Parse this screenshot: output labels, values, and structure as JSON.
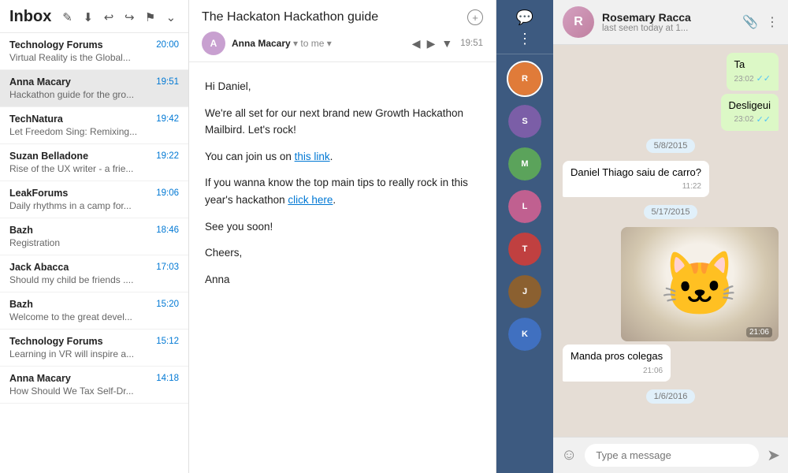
{
  "inbox": {
    "title": "Inbox",
    "toolbar_icons": [
      "compose",
      "download",
      "undo",
      "redo",
      "flag",
      "dropdown"
    ],
    "emails": [
      {
        "sender": "Technology Forums",
        "time": "20:00",
        "preview": "Virtual Reality is the Global..."
      },
      {
        "sender": "Anna Macary",
        "time": "19:51",
        "preview": "Hackathon guide for the gro...",
        "selected": true
      },
      {
        "sender": "TechNatura",
        "time": "19:42",
        "preview": "Let Freedom Sing: Remixing..."
      },
      {
        "sender": "Suzan Belladone",
        "time": "19:22",
        "preview": "Rise of the UX writer - a frie..."
      },
      {
        "sender": "LeakForums",
        "time": "19:06",
        "preview": "Daily rhythms in a camp for..."
      },
      {
        "sender": "Bazh",
        "time": "18:46",
        "preview": "Registration"
      },
      {
        "sender": "Jack Abacca",
        "time": "17:03",
        "preview": "Should my child be friends ...."
      },
      {
        "sender": "Bazh",
        "time": "15:20",
        "preview": "Welcome to the great devel..."
      },
      {
        "sender": "Technology Forums",
        "time": "15:12",
        "preview": "Learning in VR will inspire a..."
      },
      {
        "sender": "Anna Macary",
        "time": "14:18",
        "preview": "How Should We Tax Self-Dr..."
      }
    ]
  },
  "email_view": {
    "subject": "The Hackaton Hackathon guide",
    "from_name": "Anna Macary",
    "from_label": "to me",
    "time": "19:51",
    "body": {
      "greeting": "Hi Daniel,",
      "para1": "We're all set for our next brand new Growth Hackathon Mailbird. Let's rock!",
      "para2_pre": "You can join us on ",
      "para2_link": "this link",
      "para2_post": ".",
      "para3_pre": "If you wanna know the top main tips to really rock in this year's hackathon ",
      "para3_link": "click here",
      "para3_post": ".",
      "sign1": "See you soon!",
      "sign2": "Cheers,",
      "sign3": "Anna"
    }
  },
  "chat": {
    "header": {
      "name": "Rosemary Racca",
      "status": "last seen today at 1..."
    },
    "contacts": [
      {
        "initials": "R",
        "color": "#e07b39",
        "active": true
      },
      {
        "initials": "S",
        "color": "#7b5ea7"
      },
      {
        "initials": "M",
        "color": "#5ba35b"
      },
      {
        "initials": "L",
        "color": "#c06090"
      },
      {
        "initials": "T",
        "color": "#c04040"
      },
      {
        "initials": "J",
        "color": "#8b6030"
      },
      {
        "initials": "K",
        "color": "#4070c0"
      }
    ],
    "messages": [
      {
        "type": "sent",
        "text": "Ta",
        "time": "23:02",
        "check": true
      },
      {
        "type": "sent",
        "text": "Desligeui",
        "time": "23:02",
        "check": true
      },
      {
        "date": "5/8/2015"
      },
      {
        "type": "received",
        "text": "Daniel Thiago saiu de carro?",
        "time": "11:22"
      },
      {
        "date": "5/17/2015"
      },
      {
        "type": "image",
        "time": "21:06"
      },
      {
        "type": "received",
        "text": "Manda pros colegas",
        "time": "21:06"
      },
      {
        "date": "1/6/2016"
      }
    ],
    "input_placeholder": "Type a message"
  }
}
